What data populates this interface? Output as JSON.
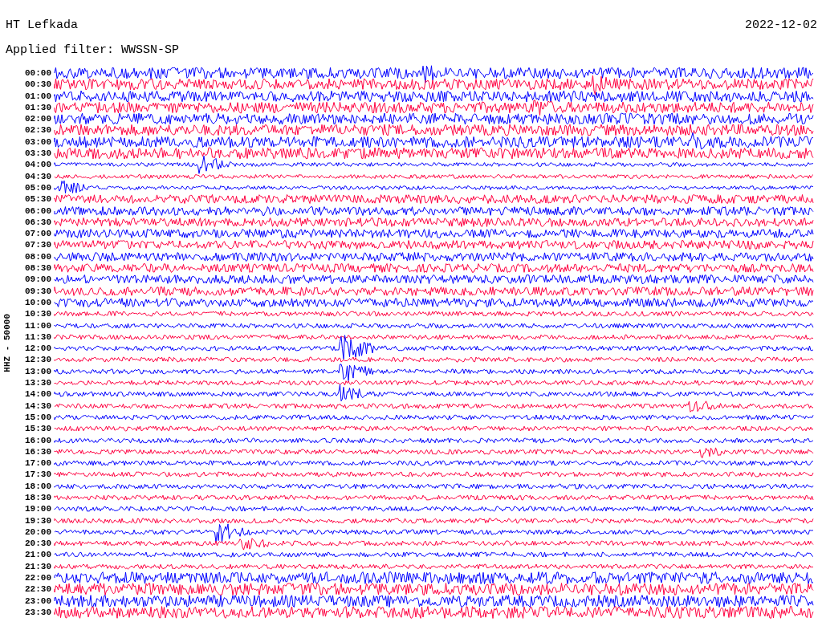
{
  "title": "HT Lefkada",
  "date": "2022-12-02",
  "filter": "Applied filter: WWSSN-SP",
  "axis_label": "HHZ - 50000",
  "rows": [
    {
      "label": "00:00",
      "color": "#0000ff"
    },
    {
      "label": "00:30",
      "color": "#ff0040"
    },
    {
      "label": "01:00",
      "color": "#0000ff"
    },
    {
      "label": "01:30",
      "color": "#ff0040"
    },
    {
      "label": "02:00",
      "color": "#0000ff"
    },
    {
      "label": "02:30",
      "color": "#ff0040"
    },
    {
      "label": "03:00",
      "color": "#0000ff"
    },
    {
      "label": "03:30",
      "color": "#ff0040"
    },
    {
      "label": "04:00",
      "color": "#0000ff"
    },
    {
      "label": "04:30",
      "color": "#ff0040"
    },
    {
      "label": "05:00",
      "color": "#0000ff"
    },
    {
      "label": "05:30",
      "color": "#ff0040"
    },
    {
      "label": "06:00",
      "color": "#0000ff"
    },
    {
      "label": "06:30",
      "color": "#ff0040"
    },
    {
      "label": "07:00",
      "color": "#0000ff"
    },
    {
      "label": "07:30",
      "color": "#ff0040"
    },
    {
      "label": "08:00",
      "color": "#0000ff"
    },
    {
      "label": "08:30",
      "color": "#ff0040"
    },
    {
      "label": "09:00",
      "color": "#0000ff"
    },
    {
      "label": "09:30",
      "color": "#ff0040"
    },
    {
      "label": "10:00",
      "color": "#0000ff"
    },
    {
      "label": "10:30",
      "color": "#ff0040"
    },
    {
      "label": "11:00",
      "color": "#0000ff"
    },
    {
      "label": "11:30",
      "color": "#ff0040"
    },
    {
      "label": "12:00",
      "color": "#0000ff"
    },
    {
      "label": "12:30",
      "color": "#ff0040"
    },
    {
      "label": "13:00",
      "color": "#0000ff"
    },
    {
      "label": "13:30",
      "color": "#ff0040"
    },
    {
      "label": "14:00",
      "color": "#0000ff"
    },
    {
      "label": "14:30",
      "color": "#ff0040"
    },
    {
      "label": "15:00",
      "color": "#0000ff"
    },
    {
      "label": "15:30",
      "color": "#ff0040"
    },
    {
      "label": "16:00",
      "color": "#0000ff"
    },
    {
      "label": "16:30",
      "color": "#ff0040"
    },
    {
      "label": "17:00",
      "color": "#0000ff"
    },
    {
      "label": "17:30",
      "color": "#ff0040"
    },
    {
      "label": "18:00",
      "color": "#0000ff"
    },
    {
      "label": "18:30",
      "color": "#ff0040"
    },
    {
      "label": "19:00",
      "color": "#0000ff"
    },
    {
      "label": "19:30",
      "color": "#ff0040"
    },
    {
      "label": "20:00",
      "color": "#0000ff"
    },
    {
      "label": "20:30",
      "color": "#ff0040"
    },
    {
      "label": "21:00",
      "color": "#0000ff"
    },
    {
      "label": "21:30",
      "color": "#ff0040"
    },
    {
      "label": "22:00",
      "color": "#0000ff"
    },
    {
      "label": "22:30",
      "color": "#ff0040"
    },
    {
      "label": "23:00",
      "color": "#0000ff"
    },
    {
      "label": "23:30",
      "color": "#ff0040"
    }
  ]
}
